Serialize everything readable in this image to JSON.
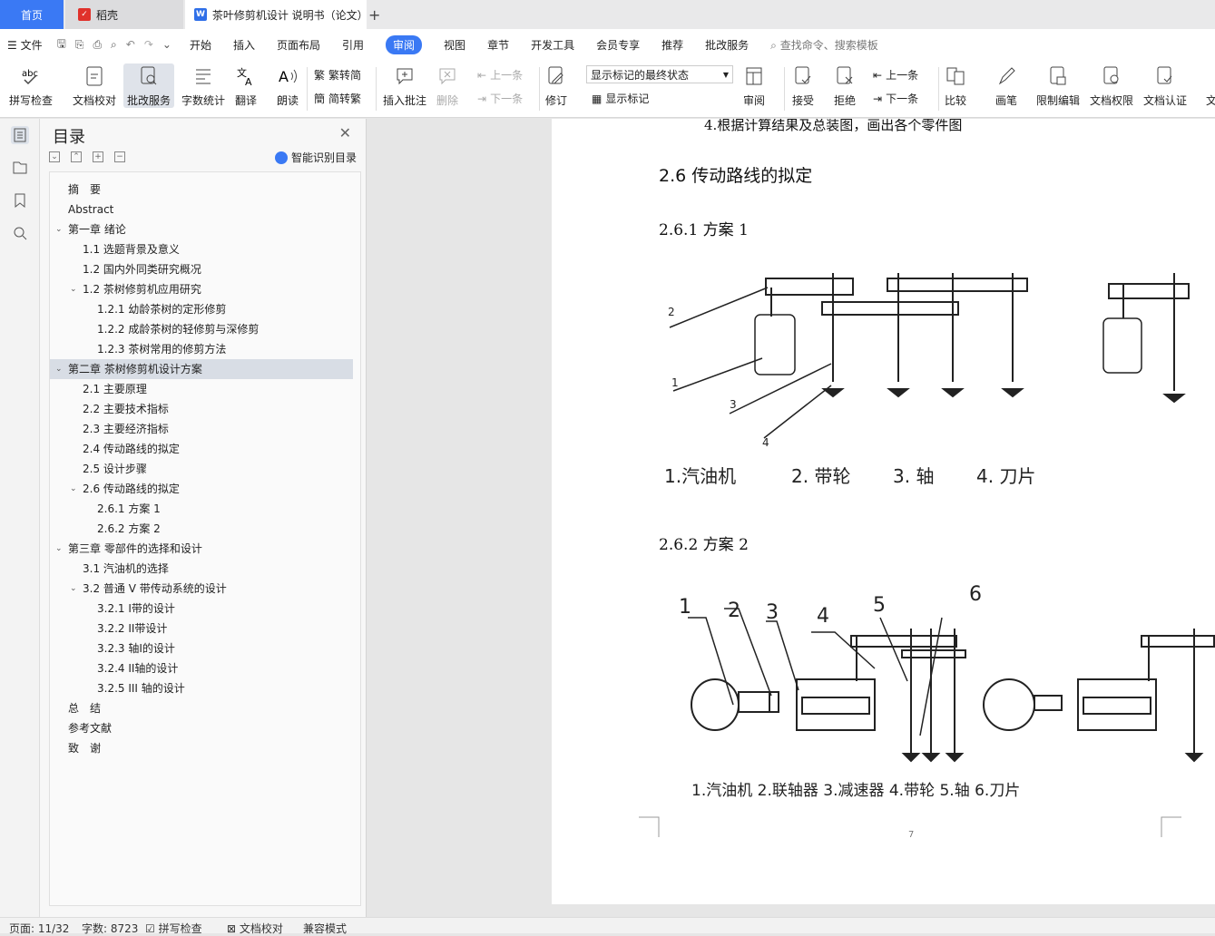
{
  "tabs": {
    "home": "首页",
    "daoke": "稻壳",
    "doc": "茶叶修剪机设计 说明书（论文）",
    "new": "+"
  },
  "menu": {
    "file": "文件",
    "items": [
      "开始",
      "插入",
      "页面布局",
      "引用",
      "审阅",
      "视图",
      "章节",
      "开发工具",
      "会员专享",
      "推荐",
      "批改服务"
    ],
    "active": "审阅",
    "search": "查找命令、搜索模板"
  },
  "toolbar": {
    "spell": "拼写检查",
    "proof": "文档校对",
    "grade": "批改服务",
    "count": "字数统计",
    "translate": "翻译",
    "read": "朗读",
    "trad": "繁转简",
    "simp": "简转繁",
    "comment": "插入批注",
    "delete": "删除",
    "prev_c": "上一条",
    "next_c": "下一条",
    "revise": "修订",
    "markup_state": "显示标记的最终状态",
    "show_markup": "显示标记",
    "review": "审阅",
    "accept": "接受",
    "reject": "拒绝",
    "prev": "上一条",
    "next": "下一条",
    "compare": "比较",
    "pen": "画笔",
    "restrict": "限制编辑",
    "perm": "文档权限",
    "cert": "文档认证",
    "more": "文"
  },
  "nav": {
    "title": "目录",
    "smart": "智能识别目录",
    "ctrls": [
      "⌄",
      "⌃",
      "+",
      "−"
    ]
  },
  "toc": [
    {
      "t": "摘　要",
      "lv": 1,
      "ar": ""
    },
    {
      "t": "Abstract",
      "lv": 1,
      "ar": ""
    },
    {
      "t": "第一章  绪论",
      "lv": 1,
      "ar": "v"
    },
    {
      "t": "1.1 选题背景及意义",
      "lv": 2,
      "ar": ""
    },
    {
      "t": "1.2 国内外同类研究概况",
      "lv": 2,
      "ar": ""
    },
    {
      "t": "1.2 茶树修剪机应用研究",
      "lv": 2,
      "ar": "v"
    },
    {
      "t": "1.2.1 幼龄茶树的定形修剪",
      "lv": 3,
      "ar": ""
    },
    {
      "t": "1.2.2 成龄茶树的轻修剪与深修剪",
      "lv": 3,
      "ar": ""
    },
    {
      "t": "1.2.3 茶树常用的修剪方法",
      "lv": 3,
      "ar": ""
    },
    {
      "t": "第二章  茶树修剪机设计方案",
      "lv": 1,
      "ar": "v",
      "hl": true
    },
    {
      "t": "2.1 主要原理",
      "lv": 2,
      "ar": ""
    },
    {
      "t": "2.2 主要技术指标",
      "lv": 2,
      "ar": ""
    },
    {
      "t": "2.3 主要经济指标",
      "lv": 2,
      "ar": ""
    },
    {
      "t": "2.4 传动路线的拟定",
      "lv": 2,
      "ar": ""
    },
    {
      "t": "2.5 设计步骤",
      "lv": 2,
      "ar": ""
    },
    {
      "t": "2.6 传动路线的拟定",
      "lv": 2,
      "ar": "v"
    },
    {
      "t": "2.6.1 方案 1",
      "lv": 3,
      "ar": ""
    },
    {
      "t": "2.6.2 方案 2",
      "lv": 3,
      "ar": ""
    },
    {
      "t": "第三章  零部件的选择和设计",
      "lv": 1,
      "ar": "v"
    },
    {
      "t": "3.1 汽油机的选择",
      "lv": 2,
      "ar": ""
    },
    {
      "t": "3.2 普通 V 带传动系统的设计",
      "lv": 2,
      "ar": "v"
    },
    {
      "t": "3.2.1 I带的设计",
      "lv": 3,
      "ar": ""
    },
    {
      "t": "3.2.2 II带设计",
      "lv": 3,
      "ar": ""
    },
    {
      "t": "3.2.3 轴I的设计",
      "lv": 3,
      "ar": ""
    },
    {
      "t": "3.2.4 II轴的设计",
      "lv": 3,
      "ar": ""
    },
    {
      "t": "3.2.5 III  轴的设计",
      "lv": 3,
      "ar": ""
    },
    {
      "t": "总　结",
      "lv": 1,
      "ar": ""
    },
    {
      "t": "参考文献",
      "lv": 1,
      "ar": ""
    },
    {
      "t": "致　谢",
      "lv": 1,
      "ar": ""
    }
  ],
  "doc": {
    "top_line": "4.根据计算结果及总装图，画出各个零件图",
    "h26": "2.6 传动路线的拟定",
    "h261": "2.6.1 方案 1",
    "h262": "2.6.2 方案 2",
    "fig1_labels": [
      "2",
      "1",
      "3",
      "4"
    ],
    "fig1_caption": [
      "1.汽油机",
      "2. 带轮",
      "3. 轴",
      "4. 刀片"
    ],
    "fig2_labels": [
      "1",
      "2",
      "3",
      "4",
      "5",
      "6"
    ],
    "fig2_caption": "1.汽油机  2.联轴器  3.减速器  4.带轮  5.轴  6.刀片",
    "page_num": "7"
  },
  "status": {
    "page": "页面: 11/32",
    "words": "字数: 8723",
    "spell": "拼写检查",
    "proof": "文档校对",
    "compat": "兼容模式"
  }
}
